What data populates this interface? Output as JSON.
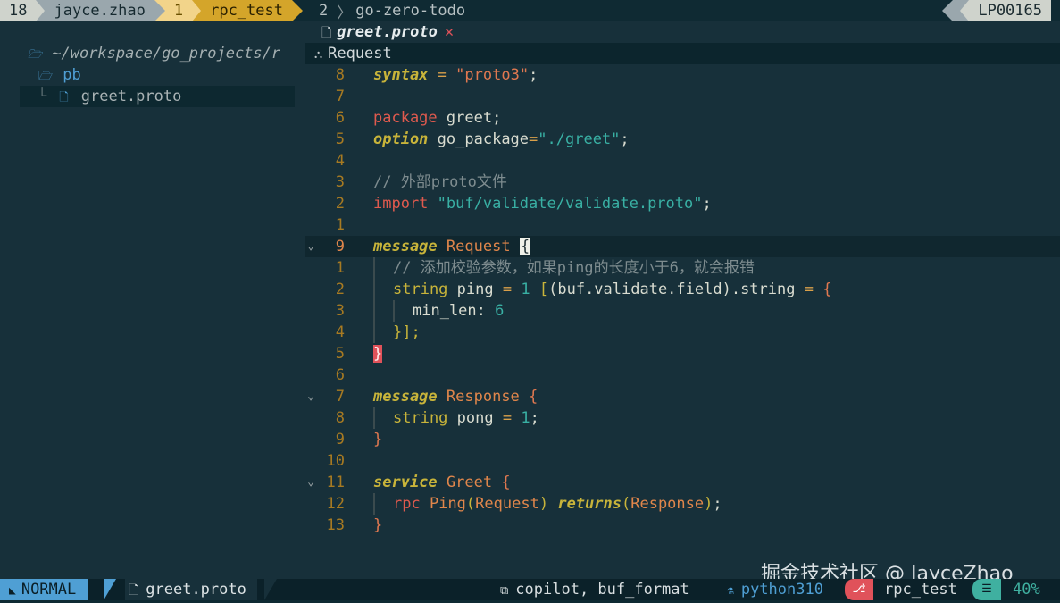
{
  "tmux": {
    "session_num": "18",
    "user": "jayce.zhao",
    "active_win_num": "1",
    "active_win_name": "rpc_test",
    "inactive_win_num": "2",
    "inactive_win_name": "go-zero-todo",
    "host": "LP00165"
  },
  "tree": {
    "root": "~/workspace/go_projects/r",
    "folder": "pb",
    "file_guide": "└",
    "file": "greet.proto"
  },
  "tab": {
    "name": "greet.proto",
    "close": "✕"
  },
  "winbar": {
    "symbol": "Request"
  },
  "code": {
    "lines": [
      {
        "num": "8"
      },
      {
        "num": "7"
      },
      {
        "num": "6"
      },
      {
        "num": "5"
      },
      {
        "num": "4"
      },
      {
        "num": "3"
      },
      {
        "num": "2"
      },
      {
        "num": "1"
      },
      {
        "num": "9"
      },
      {
        "num": "1"
      },
      {
        "num": "2"
      },
      {
        "num": "3"
      },
      {
        "num": "4"
      },
      {
        "num": "5"
      },
      {
        "num": "6"
      },
      {
        "num": "7"
      },
      {
        "num": "8"
      },
      {
        "num": "9"
      },
      {
        "num": "10"
      },
      {
        "num": "11"
      },
      {
        "num": "12"
      },
      {
        "num": "13"
      }
    ],
    "t": {
      "syntax": "syntax",
      "eq": "=",
      "proto3": "\"proto3\"",
      "semi": ";",
      "package": "package",
      "greet": "greet",
      "option": "option",
      "go_package": "go_package",
      "gopkg_val": "\"./greet\"",
      "comment1": "// 外部proto文件",
      "import": "import",
      "import_path": "\"buf/validate/validate.proto\"",
      "message": "message",
      "Request": "Request",
      "lbrace": "{",
      "comment2": "// 添加校验参数，如果ping的长度小于6，就会报错",
      "string": "string",
      "ping": "ping",
      "one": "1",
      "field_opt": "(buf.validate.field)",
      "dot_string": ".string",
      "min_len": "min_len:",
      "six": "6",
      "close_opt": "}];",
      "rbrace": "}",
      "Response": "Response",
      "pong": "pong",
      "service": "service",
      "Greet": "Greet",
      "rpc": "rpc",
      "Ping": "Ping",
      "returns": "returns"
    }
  },
  "statusline": {
    "mode": "NORMAL",
    "file": "greet.proto",
    "lsp": "copilot, buf_format",
    "python": "python310",
    "branch": "rpc_test",
    "position": "40%"
  },
  "watermark": "掘金技术社区 @ JayceZhao",
  "icons": {
    "folder": "folder-icon",
    "file": "file-icon",
    "fold": "fold-chevron-icon",
    "winbar": "symbol-icon",
    "mode": "vim-mode-icon",
    "lsp": "lsp-icon",
    "python": "python-icon",
    "git": "git-branch-icon",
    "position": "scroll-position-icon"
  }
}
